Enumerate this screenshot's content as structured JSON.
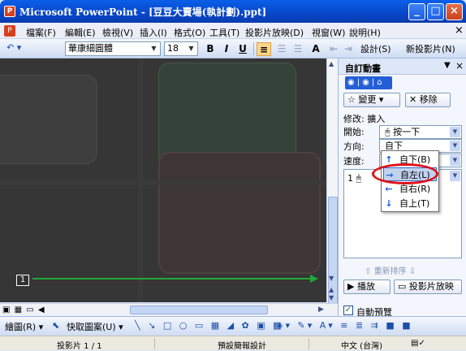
{
  "window": {
    "icon_label": "P",
    "title": "Microsoft PowerPoint - [豆豆大賣場(執計劃).ppt]",
    "minimize": "_",
    "maximize": "□",
    "close": "×"
  },
  "menu": {
    "items": [
      "檔案(F)",
      "編輯(E)",
      "檢視(V)",
      "插入(I)",
      "格式(O)",
      "工具(T)",
      "投影片放映(D)",
      "視窗(W)",
      "說明(H)"
    ],
    "close": "×"
  },
  "toolbar": {
    "undo": "↶ ▾",
    "font": "華康細圓體",
    "size": "18",
    "bold": "B",
    "italic": "I",
    "underline": "U",
    "align": "≡",
    "indent": "A",
    "design": "設計(S)",
    "new_slide": "新投影片(N)"
  },
  "slide": {
    "number_badge": "1",
    "colors": {
      "bg": "#363636",
      "line": "#1fa839"
    }
  },
  "task_pane": {
    "title": "自訂動畫",
    "change_button": "變更",
    "remove_button": "移除",
    "modify_label": "修改: 擴入",
    "start_label": "開始:",
    "start_value": "按一下",
    "direction_label": "方向:",
    "direction_value": "自下",
    "speed_label": "速度:",
    "list_item": "1",
    "reorder_label": "重新排序",
    "play_button": "播放",
    "slideshow_button": "投影片放映",
    "autopreview_label": "自動預覽",
    "autopreview_checked": "✓"
  },
  "direction_menu": {
    "items": [
      {
        "arrow": "↑",
        "label": "自下(B)"
      },
      {
        "arrow": "→",
        "label": "自左(L)"
      },
      {
        "arrow": "←",
        "label": "自右(R)"
      },
      {
        "arrow": "↓",
        "label": "自上(T)"
      }
    ]
  },
  "drawbar": {
    "draw": "繪圖(R) ▾",
    "autoshapes": "快取圖案(U) ▾"
  },
  "status": {
    "slide": "投影片 1 / 1",
    "design": "預設簡報設計",
    "language": "中文 (台灣)"
  }
}
